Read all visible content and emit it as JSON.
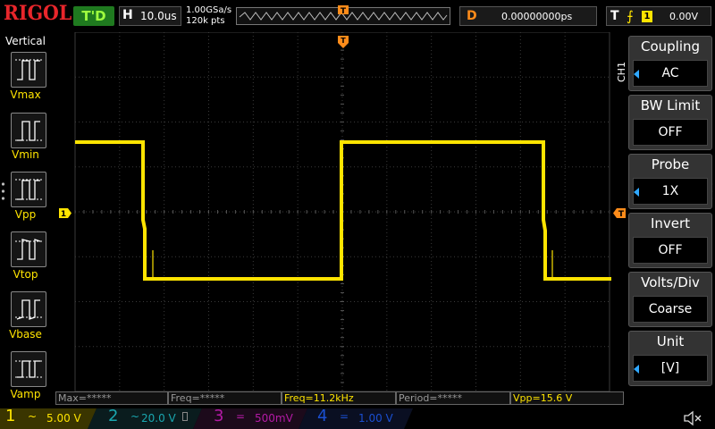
{
  "top": {
    "logo": "RIGOL",
    "status": "T'D",
    "horizontal": {
      "label": "H",
      "value": "10.0us"
    },
    "sample_rate": "1.00GSa/s",
    "memory_depth": "120k pts",
    "delay": {
      "label": "D",
      "value": "0.00000000ps"
    },
    "trigger": {
      "label": "T",
      "edge": "rising-edge-icon",
      "source": "1",
      "level": "0.00V"
    }
  },
  "left_panel": {
    "title": "Vertical",
    "items": [
      "Vmax",
      "Vmin",
      "Vpp",
      "Vtop",
      "Vbase",
      "Vamp"
    ]
  },
  "right_menu": {
    "channel_tab": "CH1",
    "items": [
      {
        "title": "Coupling",
        "value": "AC"
      },
      {
        "title": "BW Limit",
        "value": "OFF"
      },
      {
        "title": "Probe",
        "value": "1X"
      },
      {
        "title": "Invert",
        "value": "OFF"
      },
      {
        "title": "Volts/Div",
        "value": "Coarse"
      },
      {
        "title": "Unit",
        "value": "[V]"
      }
    ]
  },
  "measurements": [
    {
      "text": "Max=*****"
    },
    {
      "text": "Freq=*****"
    },
    {
      "text": "Freq=11.2kHz"
    },
    {
      "text": "Period=*****"
    },
    {
      "text": "Vpp=15.6 V"
    }
  ],
  "channels": [
    {
      "num": "1",
      "coupling": "~",
      "scale": "5.00 V",
      "color": "#ffe400",
      "active": true
    },
    {
      "num": "2",
      "coupling": "~",
      "scale": "20.0 V",
      "color": "#1aa7b0",
      "active": false
    },
    {
      "num": "3",
      "coupling": "=",
      "scale": "500mV",
      "color": "#b31aa5",
      "active": false
    },
    {
      "num": "4",
      "coupling": "=",
      "scale": "1.00 V",
      "color": "#1a4fd1",
      "active": false
    }
  ],
  "markers": {
    "channel_1_ground": "1"
  },
  "colors": {
    "ch1": "#ffe400",
    "accent": "#ff8c1a",
    "logo": "#e8262b",
    "status_bg": "#1f7a1f"
  }
}
